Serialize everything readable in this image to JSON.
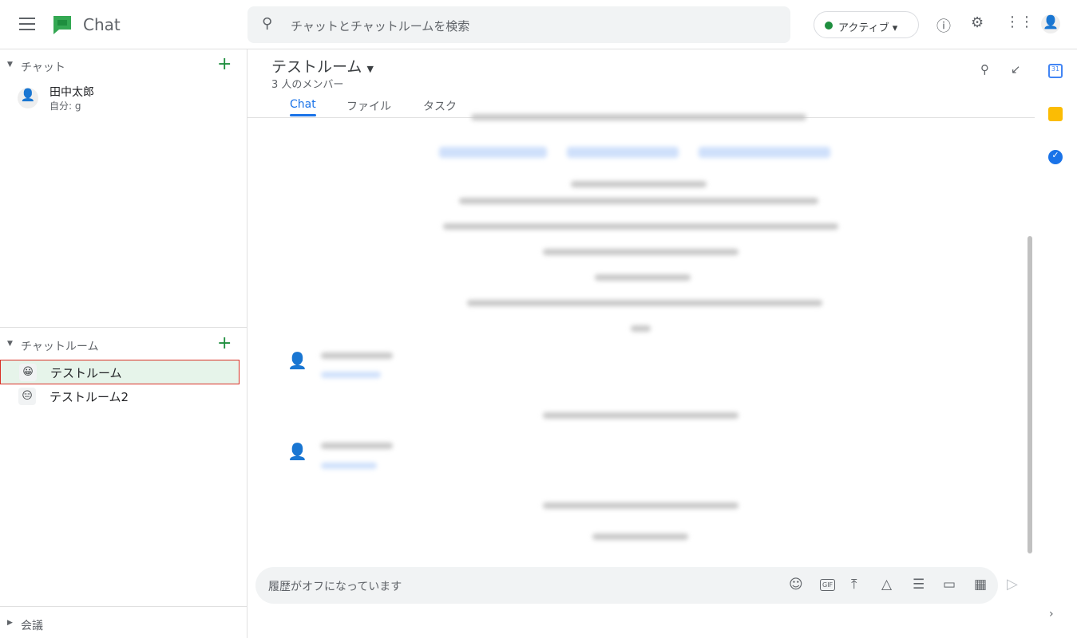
{
  "app": {
    "title": "Chat",
    "search_placeholder": "チャットとチャットルームを検索",
    "status": "アクティブ"
  },
  "sidebar": {
    "chat_section": {
      "label": "チャット",
      "items": [
        {
          "name": "田中太郎",
          "sub": "自分: g"
        }
      ]
    },
    "rooms_section": {
      "label": "チャットルーム",
      "items": [
        {
          "name": "テストルーム",
          "emoji": "😀",
          "selected": true
        },
        {
          "name": "テストルーム2",
          "emoji": "😑"
        }
      ]
    },
    "meet_section": {
      "label": "会議"
    }
  },
  "room": {
    "title": "テストルーム",
    "members": "3 人のメンバー",
    "tabs": [
      {
        "label": "Chat",
        "active": true
      },
      {
        "label": "ファイル"
      },
      {
        "label": "タスク"
      }
    ]
  },
  "composer": {
    "placeholder": "履歴がオフになっています"
  },
  "colors": {
    "accent": "#1a73e8",
    "active_green": "#1e8e3e",
    "selected_bg": "#e6f4ea",
    "highlight_border": "#d93025"
  }
}
